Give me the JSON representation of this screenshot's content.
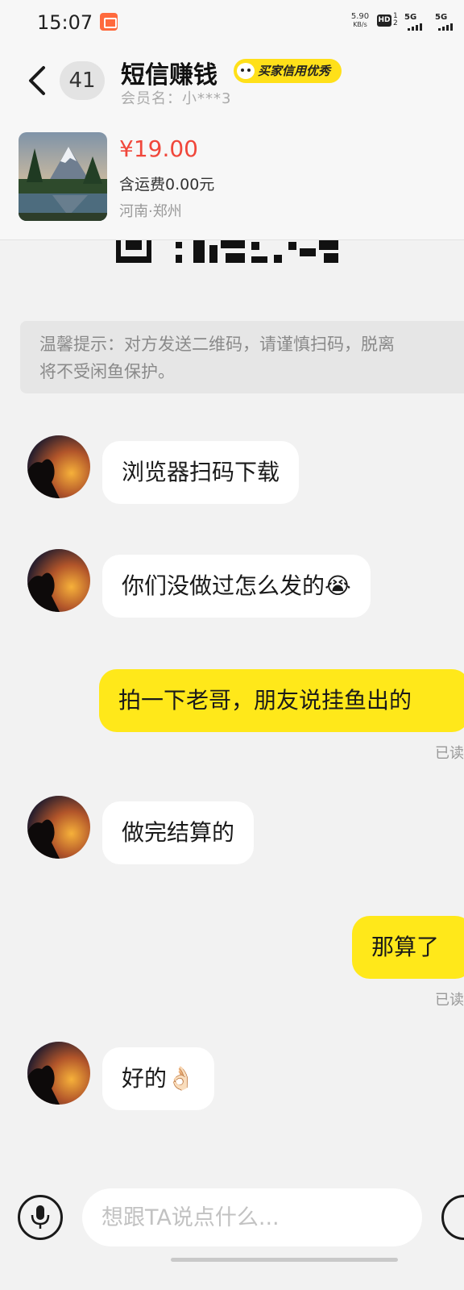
{
  "status_bar": {
    "time": "15:07",
    "net_speed_value": "5.90",
    "net_speed_unit": "KB/s",
    "hd_label": "HD",
    "sim_slots": "1\n2",
    "signal1_label": "5G",
    "signal2_label": "5G",
    "app_icon": "taobao-app-icon"
  },
  "header": {
    "back_icon": "chevron-left-icon",
    "unread_count": "41",
    "title": "短信赚钱",
    "credit_badge": "买家信用优秀",
    "member_name": "会员名：小***3"
  },
  "product": {
    "price": "¥19.00",
    "shipping": "含运费0.00元",
    "location": "河南·郑州"
  },
  "chat": {
    "notice_line1": "温馨提示：对方发送二维码，请谨慎扫码，脱离",
    "notice_line2": "将不受闲鱼保护。",
    "messages": [
      {
        "side": "left",
        "text": "浏览器扫码下载"
      },
      {
        "side": "left",
        "text": "你们没做过怎么发的😭"
      },
      {
        "side": "right",
        "text": "拍一下老哥，朋友说挂鱼出的",
        "status": "已读"
      },
      {
        "side": "left",
        "text": "做完结算的"
      },
      {
        "side": "right",
        "text": "那算了",
        "status": "已读"
      },
      {
        "side": "left",
        "text": "好的👌🏻"
      }
    ]
  },
  "input_bar": {
    "placeholder": "想跟TA说点什么...",
    "voice_icon": "microphone-icon",
    "more_icon": "plus-icon"
  },
  "colors": {
    "accent_yellow": "#ffe81a",
    "price_red": "#f0473b",
    "background": "#f2f2f2"
  }
}
